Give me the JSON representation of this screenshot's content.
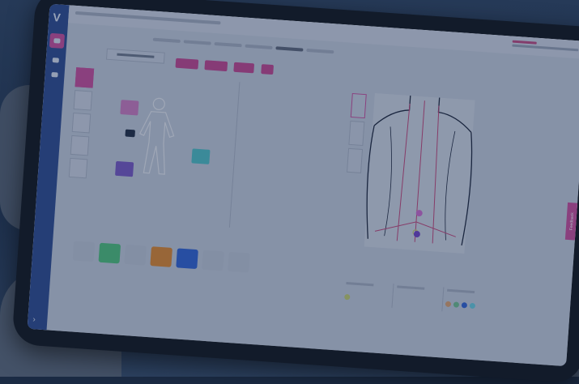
{
  "app": {
    "logo": "V"
  },
  "toolbar": {
    "buttons": []
  },
  "feedback": {
    "label": "Feedback"
  },
  "colors": {
    "accent": "#cf4d9c",
    "sidebar": "#2d4a8f",
    "palette": [
      "#c4cbd8",
      "#4fc67a",
      "#c4cbd8",
      "#e58a2a",
      "#2f63d6",
      "#c4cbd8",
      "#c4cbd8"
    ],
    "markers": [
      "#d46bd0",
      "#7242c9",
      "#c9d26c"
    ],
    "bottom_dots": [
      "#e2a36d",
      "#72c28f",
      "#2f63d6",
      "#6ad0e0"
    ]
  },
  "icons": {
    "camera": "camera-icon",
    "feedback": "feedback-icon",
    "collapse": "chevron-right-icon"
  }
}
